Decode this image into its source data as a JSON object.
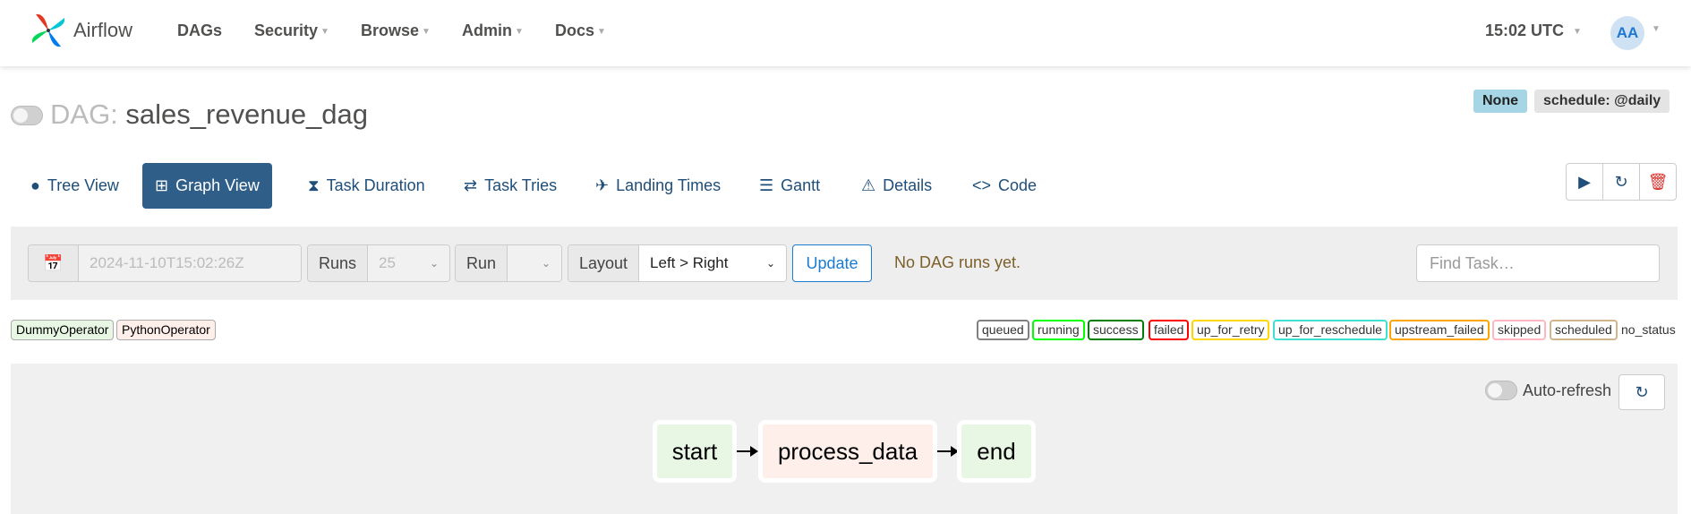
{
  "navbar": {
    "brand": "Airflow",
    "items": [
      {
        "label": "DAGs",
        "caret": false
      },
      {
        "label": "Security",
        "caret": true
      },
      {
        "label": "Browse",
        "caret": true
      },
      {
        "label": "Admin",
        "caret": true
      },
      {
        "label": "Docs",
        "caret": true
      }
    ],
    "clock": "15:02 UTC",
    "avatar": "AA"
  },
  "dag": {
    "prefix": "DAG:",
    "name": "sales_revenue_dag",
    "badge_none": "None",
    "badge_schedule": "schedule: @daily",
    "paused": true
  },
  "tabs": [
    {
      "label": "Tree View",
      "icon": "tree-icon",
      "active": false
    },
    {
      "label": "Graph View",
      "icon": "graph-icon",
      "active": true
    },
    {
      "label": "Task Duration",
      "icon": "hourglass-icon",
      "active": false
    },
    {
      "label": "Task Tries",
      "icon": "repeat-icon",
      "active": false
    },
    {
      "label": "Landing Times",
      "icon": "plane-landing-icon",
      "active": false
    },
    {
      "label": "Gantt",
      "icon": "gantt-icon",
      "active": false
    },
    {
      "label": "Details",
      "icon": "warning-triangle-icon",
      "active": false
    },
    {
      "label": "Code",
      "icon": "code-icon",
      "active": false
    }
  ],
  "actions": {
    "trigger": "play-icon",
    "refresh": "refresh-icon",
    "delete": "trash-icon"
  },
  "filters": {
    "date_value": "2024-11-10T15:02:26Z",
    "runs_label": "Runs",
    "runs_value": "25",
    "run_label": "Run",
    "run_value": "",
    "layout_label": "Layout",
    "layout_value": "Left > Right",
    "update_label": "Update",
    "status_text": "No DAG runs yet.",
    "find_placeholder": "Find Task…"
  },
  "operators": [
    {
      "label": "DummyOperator",
      "color": "#e8f7e4"
    },
    {
      "label": "PythonOperator",
      "color": "#ffefeb"
    }
  ],
  "states": [
    {
      "label": "queued",
      "color": "#808080"
    },
    {
      "label": "running",
      "color": "#00ff00"
    },
    {
      "label": "success",
      "color": "#008000"
    },
    {
      "label": "failed",
      "color": "#ff0000"
    },
    {
      "label": "up_for_retry",
      "color": "#ffd700"
    },
    {
      "label": "up_for_reschedule",
      "color": "#40e0d0"
    },
    {
      "label": "upstream_failed",
      "color": "#ffa500"
    },
    {
      "label": "skipped",
      "color": "#ffb6c1"
    },
    {
      "label": "scheduled",
      "color": "#d2b48c"
    },
    {
      "label": "no_status",
      "color": null
    }
  ],
  "graph": {
    "autorefresh_label": "Auto-refresh",
    "nodes": [
      {
        "label": "start",
        "type": "DummyOperator"
      },
      {
        "label": "process_data",
        "type": "PythonOperator"
      },
      {
        "label": "end",
        "type": "DummyOperator"
      }
    ]
  }
}
